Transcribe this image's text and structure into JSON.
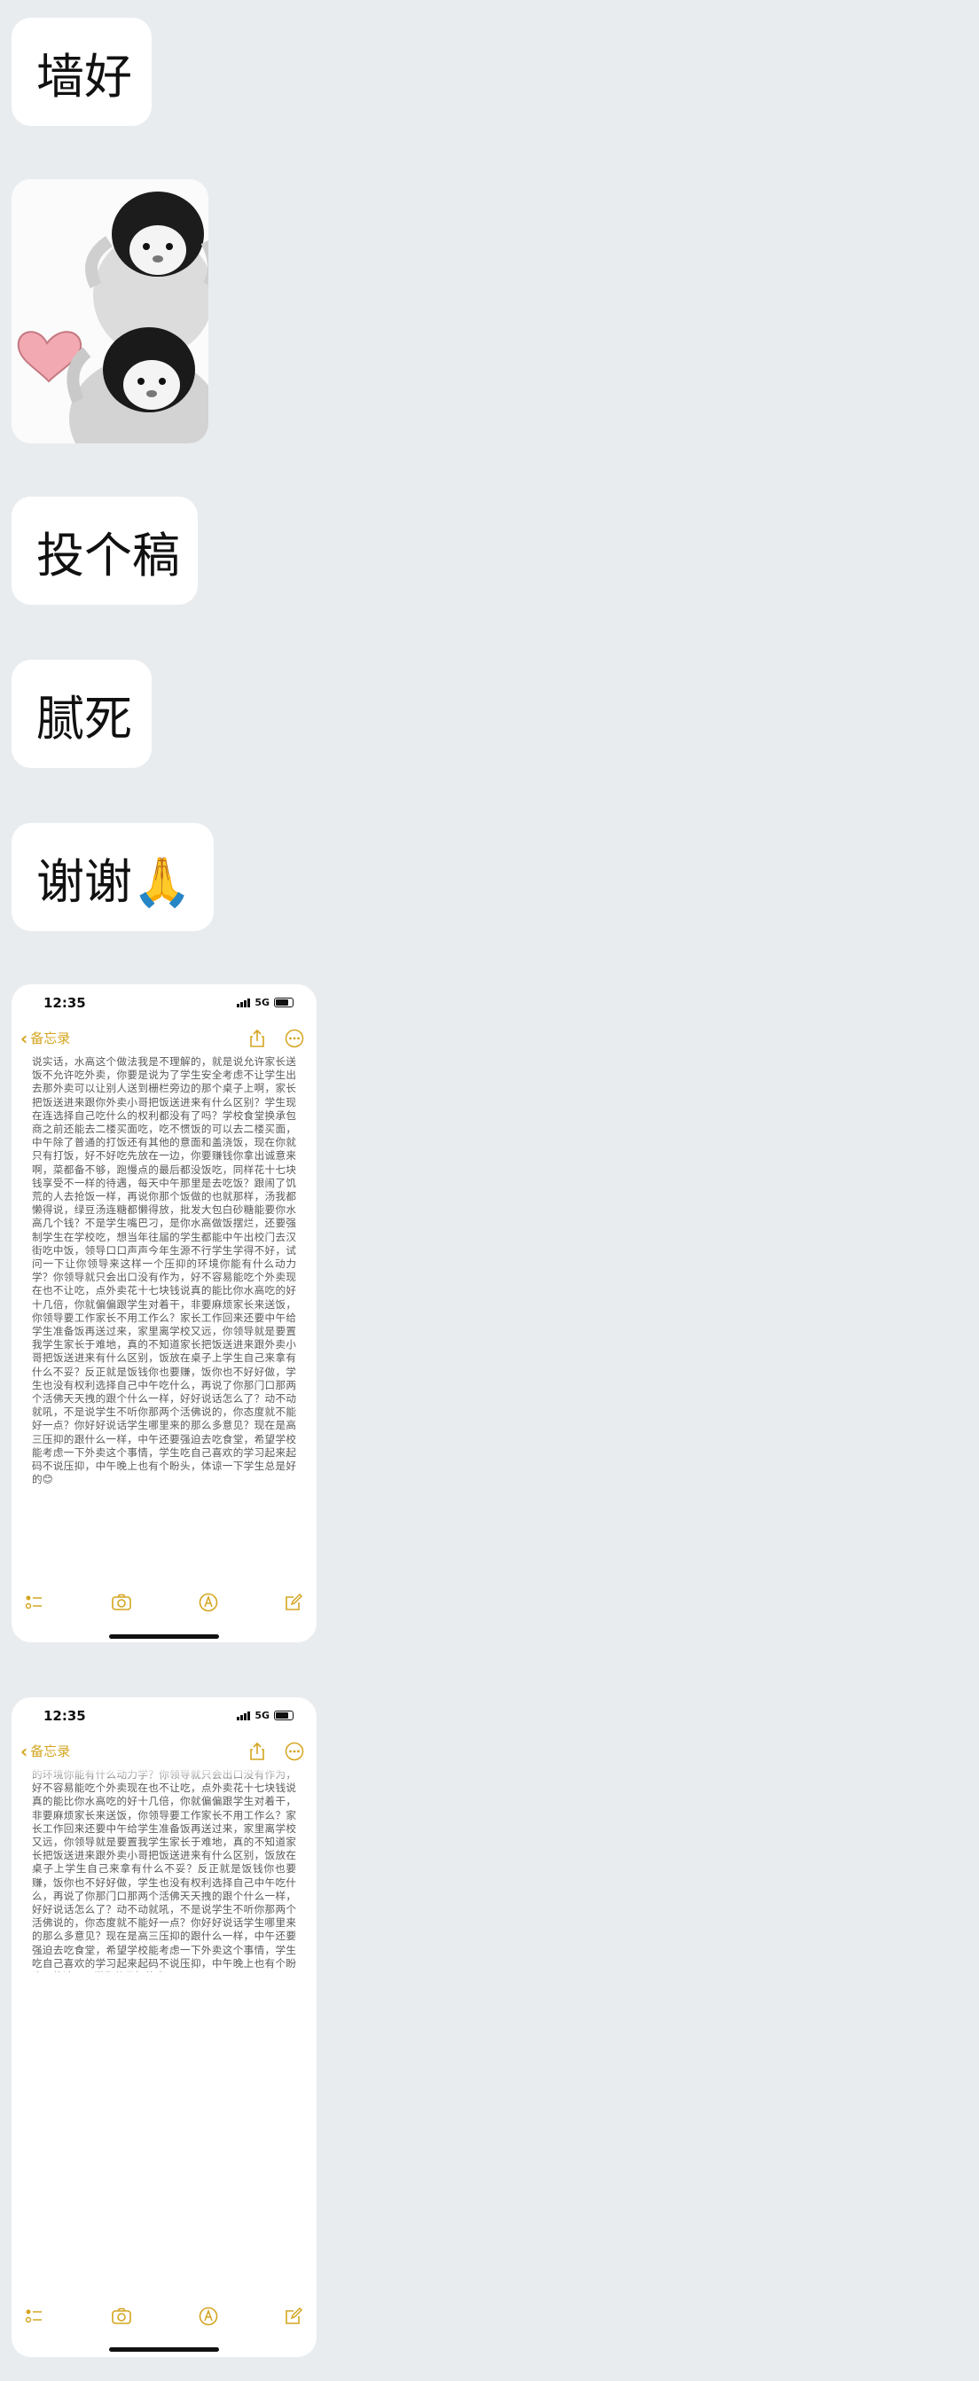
{
  "messages": [
    {
      "text": "墙好"
    },
    {
      "type": "sticker",
      "icon": "penguin-heart-sticker"
    },
    {
      "text": "投个稿"
    },
    {
      "text": "腻死"
    },
    {
      "text": "谢谢🙏"
    }
  ],
  "screenshot1": {
    "time": "12:35",
    "network": "5G",
    "back_label": "备忘录",
    "body": "说实话，水高这个做法我是不理解的，就是说允许家长送饭不允许吃外卖，你要是说为了学生安全考虑不让学生出去那外卖可以让别人送到栅栏旁边的那个桌子上啊，家长把饭送进来跟你外卖小哥把饭送进来有什么区别？学生现在连选择自己吃什么的权利都没有了吗？学校食堂换承包商之前还能去二楼买面吃，吃不惯饭的可以去二楼买面，中午除了普通的打饭还有其他的意面和盖浇饭，现在你就只有打饭，好不好吃先放在一边，你要赚钱你拿出诚意来啊，菜都备不够，跑慢点的最后都没饭吃，同样花十七块钱享受不一样的待遇，每天中午那里是去吃饭？跟闹了饥荒的人去抢饭一样，再说你那个饭做的也就那样，汤我都懒得说，绿豆汤连糖都懒得放，批发大包白砂糖能要你水高几个钱？不是学生嘴巴刁，是你水高做饭摆烂，还要强制学生在学校吃，想当年往届的学生都能中午出校门去汉街吃中饭，领导口口声声今年生源不行学生学得不好，试问一下让你领导来这样一个压抑的环境你能有什么动力学？你领导就只会出口没有作为，好不容易能吃个外卖现在也不让吃，点外卖花十七块钱说真的能比你水高吃的好十几倍，你就偏偏跟学生对着干，非要麻烦家长来送饭，你领导要工作家长不用工作么？家长工作回来还要中午给学生准备饭再送过来，家里离学校又远，你领导就是要置我学生家长于难地，真的不知道家长把饭送进来跟外卖小哥把饭送进来有什么区别，饭放在桌子上学生自己来拿有什么不妥？反正就是饭钱你也要赚，饭你也不好好做，学生也没有权利选择自己中午吃什么，再说了你那门口那两个活佛天天拽的跟个什么一样，好好说话怎么了？动不动就吼，不是说学生不听你那两个活佛说的，你态度就不能好一点？你好好说话学生哪里来的那么多意见？现在是高三压抑的跟什么一样，中午还要强迫去吃食堂，希望学校能考虑一下外卖这个事情，学生吃自己喜欢的学习起来起码不说压抑，中午晚上也有个盼头，体谅一下学生总是好的😊",
    "icons": [
      "chevron-left-icon",
      "share-icon",
      "more-icon",
      "checklist-icon",
      "camera-icon",
      "markup-icon",
      "compose-icon"
    ]
  },
  "screenshot2": {
    "time": "12:35",
    "network": "5G",
    "back_label": "备忘录",
    "body": "的环境你能有什么动力学？你领导就只会出口没有作为，好不容易能吃个外卖现在也不让吃，点外卖花十七块钱说真的能比你水高吃的好十几倍，你就偏偏跟学生对着干，非要麻烦家长来送饭，你领导要工作家长不用工作么？家长工作回来还要中午给学生准备饭再送过来，家里离学校又远，你领导就是要置我学生家长于难地，真的不知道家长把饭送进来跟外卖小哥把饭送进来有什么区别，饭放在桌子上学生自己来拿有什么不妥？反正就是饭钱你也要赚，饭你也不好好做，学生也没有权利选择自己中午吃什么，再说了你那门口那两个活佛天天拽的跟个什么一样，好好说话怎么了？动不动就吼，不是说学生不听你那两个活佛说的，你态度就不能好一点？你好好说话学生哪里来的那么多意见？现在是高三压抑的跟什么一样，中午还要强迫去吃食堂，希望学校能考虑一下外卖这个事情，学生吃自己喜欢的学习起来起码不说压抑，中午晚上也有个盼头，体谅一下学生总是好的😊"
  },
  "colors": {
    "accent": "#d4a520",
    "background": "#e9ecef",
    "bubble": "#ffffff"
  }
}
